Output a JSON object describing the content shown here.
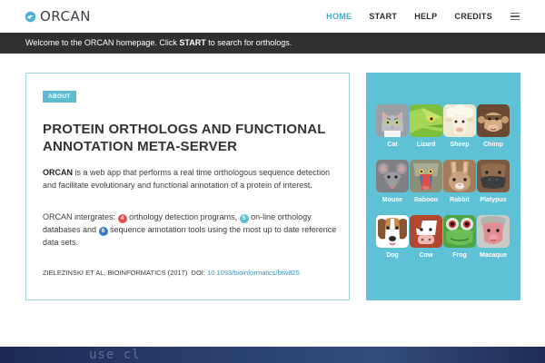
{
  "header": {
    "logo_text": "ORCAN",
    "nav": [
      {
        "label": "HOME",
        "active": true
      },
      {
        "label": "START",
        "active": false
      },
      {
        "label": "HELP",
        "active": false
      },
      {
        "label": "CREDITS",
        "active": false
      }
    ]
  },
  "welcome": {
    "prefix": "Welcome to the ORCAN homepage. Click ",
    "emphasis": "START",
    "suffix": " to search for orthologs."
  },
  "about": {
    "badge": "ABOUT",
    "title": "PROTEIN ORTHOLOGS AND FUNCTIONAL ANNOTATION META-SERVER",
    "desc_bold": "ORCAN",
    "desc_rest": " is a web app that performs a real time orthologous sequence detection and facilitate evolutionary and functional annotation of a protein of interest.",
    "tools": {
      "part1": "ORCAN intergrates: ",
      "n1": "4",
      "part2": " orthology detection programs, ",
      "n2": "5",
      "part3": " on-line orthology databases and ",
      "n3": "6",
      "part4": " sequence annotation tools using the most up to date reference data sets."
    },
    "citation": {
      "authors": "ZIELEZINSKI ET AL. BIOINFORMATICS (2017)",
      "doi_label": "DOI:",
      "doi_link": "10.1093/bioinformatics/btw825"
    }
  },
  "animals": [
    {
      "label": "Cat",
      "icon": "cat-icon"
    },
    {
      "label": "Lizard",
      "icon": "lizard-icon"
    },
    {
      "label": "Sheep",
      "icon": "sheep-icon"
    },
    {
      "label": "Chimp",
      "icon": "chimp-icon"
    },
    {
      "label": "Mouse",
      "icon": "mouse-icon"
    },
    {
      "label": "Baboon",
      "icon": "baboon-icon"
    },
    {
      "label": "Rabbit",
      "icon": "rabbit-icon"
    },
    {
      "label": "Platypus",
      "icon": "platypus-icon"
    },
    {
      "label": "Dog",
      "icon": "dog-icon"
    },
    {
      "label": "Cow",
      "icon": "cow-icon"
    },
    {
      "label": "Frog",
      "icon": "frog-icon"
    },
    {
      "label": "Macaque",
      "icon": "macaque-icon"
    }
  ],
  "bottom": {
    "code_text": "use cl"
  },
  "colors": {
    "accent": "#45a8c7",
    "panel": "#5fc1d6",
    "welcome_bar": "#2f3032",
    "badge_red": "#e1544e",
    "badge_teal": "#5dbcd2",
    "badge_blue": "#3d7cc4"
  }
}
